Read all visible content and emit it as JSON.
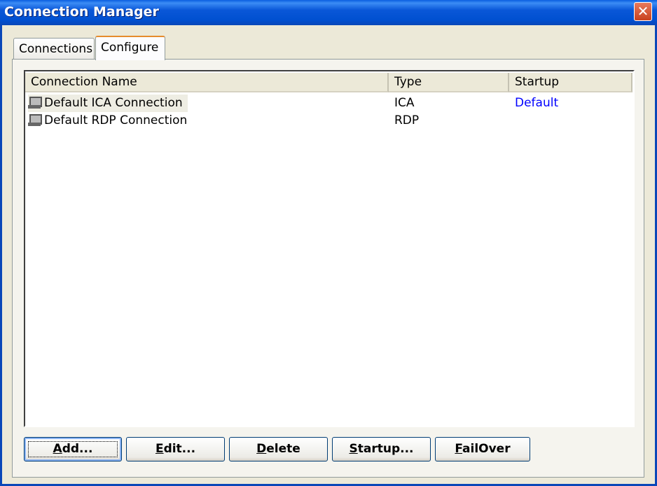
{
  "window": {
    "title": "Connection Manager",
    "close_icon": "close-icon"
  },
  "tabs": [
    {
      "label": "Connections"
    },
    {
      "label": "Configure",
      "active": true
    }
  ],
  "list": {
    "columns": [
      "Connection Name",
      "Type",
      "Startup"
    ],
    "rows": [
      {
        "name": "Default ICA Connection",
        "type": "ICA",
        "startup": "Default"
      },
      {
        "name": "Default RDP Connection",
        "type": "RDP",
        "startup": ""
      }
    ],
    "startup_color": "#0000FF"
  },
  "buttons": [
    {
      "mnemonic": "A",
      "rest": "dd..."
    },
    {
      "mnemonic": "E",
      "rest": "dit..."
    },
    {
      "mnemonic": "D",
      "rest": "elete"
    },
    {
      "mnemonic": "S",
      "rest": "tartup..."
    },
    {
      "mnemonic": "F",
      "rest": "ailOver"
    }
  ]
}
